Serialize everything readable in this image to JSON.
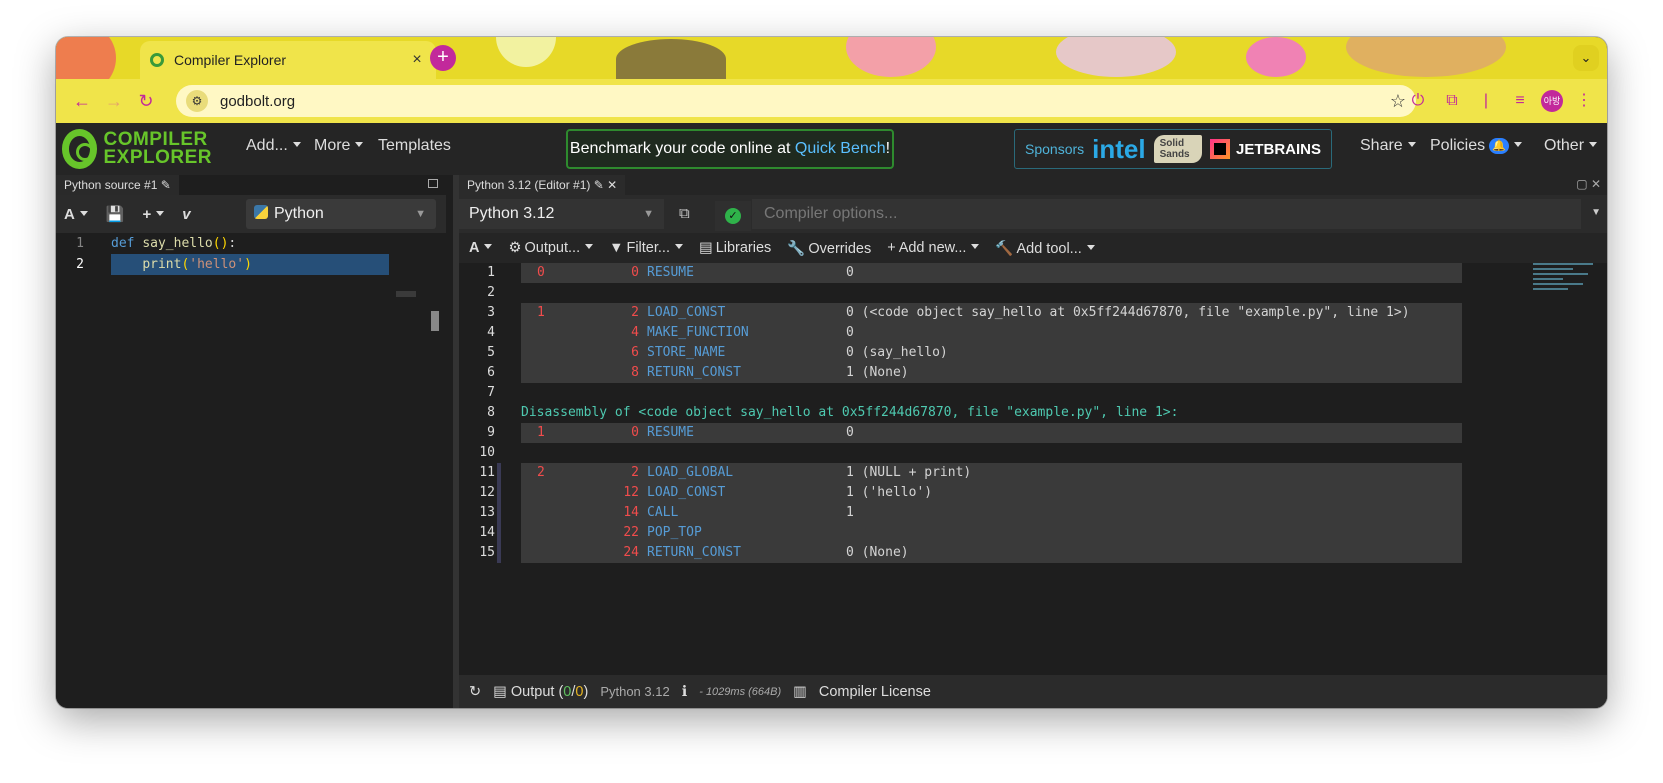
{
  "browser": {
    "tab_title": "Compiler Explorer",
    "tab_close": "×",
    "new_tab": "+",
    "tab_list": "⌄",
    "url": "godbolt.org",
    "profile_initials": "아방"
  },
  "ce_nav": {
    "logo_line1": "COMPILER",
    "logo_line2": "EXPLORER",
    "add": "Add...",
    "more": "More",
    "templates": "Templates",
    "bench_text": "Benchmark your code online at ",
    "bench_link": "Quick Bench",
    "bench_end": "!",
    "sponsors_label": "Sponsors",
    "sponsor_intel": "intel",
    "sponsor_solid": "Solid Sands",
    "sponsor_jb": "JETBRAINS",
    "share": "Share",
    "policies": "Policies",
    "other": "Other"
  },
  "source_pane": {
    "tab_title": "Python source #1",
    "language": "Python",
    "code_lines": [
      {
        "num": "1"
      },
      {
        "num": "2"
      }
    ]
  },
  "compiler_pane": {
    "tab_title": "Python 3.12 (Editor #1)",
    "compiler": "Python 3.12",
    "options_placeholder": "Compiler options...",
    "toolbar": {
      "output": "Output...",
      "filter": "Filter...",
      "libraries": "Libraries",
      "overrides": "Overrides",
      "add_new": "Add new...",
      "add_tool": "Add tool..."
    },
    "status": {
      "output_label": "Output (",
      "output_ok": "0",
      "output_sep": "/",
      "output_warn": "0",
      "output_close": ")",
      "compiler": "Python 3.12",
      "timing": "- 1029ms (664B)",
      "license": "Compiler License"
    },
    "lines": [
      {
        "n": "1",
        "src": "0",
        "off": "0",
        "op": "RESUME",
        "arg": "0"
      },
      {
        "n": "2"
      },
      {
        "n": "3",
        "src": "1",
        "off": "2",
        "op": "LOAD_CONST",
        "arg": "0 (<code object say_hello at 0x5ff244d67870, file \"example.py\", line 1>)"
      },
      {
        "n": "4",
        "off": "4",
        "op": "MAKE_FUNCTION",
        "arg": "0"
      },
      {
        "n": "5",
        "off": "6",
        "op": "STORE_NAME",
        "arg": "0 (say_hello)"
      },
      {
        "n": "6",
        "off": "8",
        "op": "RETURN_CONST",
        "arg": "1 (None)"
      },
      {
        "n": "7"
      },
      {
        "n": "8",
        "dis": "Disassembly of <code object say_hello at 0x5ff244d67870, file \"example.py\", line 1>:"
      },
      {
        "n": "9",
        "src": "1",
        "off": "0",
        "op": "RESUME",
        "arg": "0"
      },
      {
        "n": "10"
      },
      {
        "n": "11",
        "src": "2",
        "off": "2",
        "op": "LOAD_GLOBAL",
        "arg": "1 (NULL + print)"
      },
      {
        "n": "12",
        "off": "12",
        "op": "LOAD_CONST",
        "arg": "1 ('hello')"
      },
      {
        "n": "13",
        "off": "14",
        "op": "CALL",
        "arg": "1"
      },
      {
        "n": "14",
        "off": "22",
        "op": "POP_TOP",
        "arg": ""
      },
      {
        "n": "15",
        "off": "24",
        "op": "RETURN_CONST",
        "arg": "0 (None)"
      }
    ]
  }
}
